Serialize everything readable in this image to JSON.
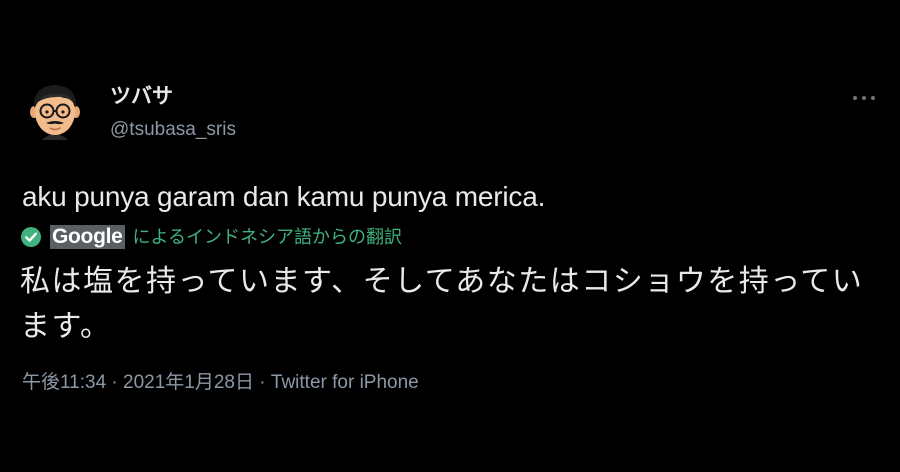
{
  "user": {
    "display_name": "ツバサ",
    "handle": "@tsubasa_sris"
  },
  "tweet": {
    "text": "aku punya garam dan kamu punya merica.",
    "translation": {
      "provider": "Google",
      "label": "によるインドネシア語からの翻訳",
      "text": "私は塩を持っています、そしてあなたはコショウを持っています。"
    },
    "time": "午後11:34",
    "date": "2021年1月28日",
    "source": "Twitter for iPhone",
    "separator": "·"
  },
  "colors": {
    "background": "#000000",
    "primary_text": "#e7e9ea",
    "secondary_text": "#8b98a5",
    "translation_green": "#3fb27f",
    "google_logo_bg": "#5a5f64"
  },
  "icons": {
    "more": "more-horizontal-icon",
    "verified_translation": "check-circle-icon"
  }
}
